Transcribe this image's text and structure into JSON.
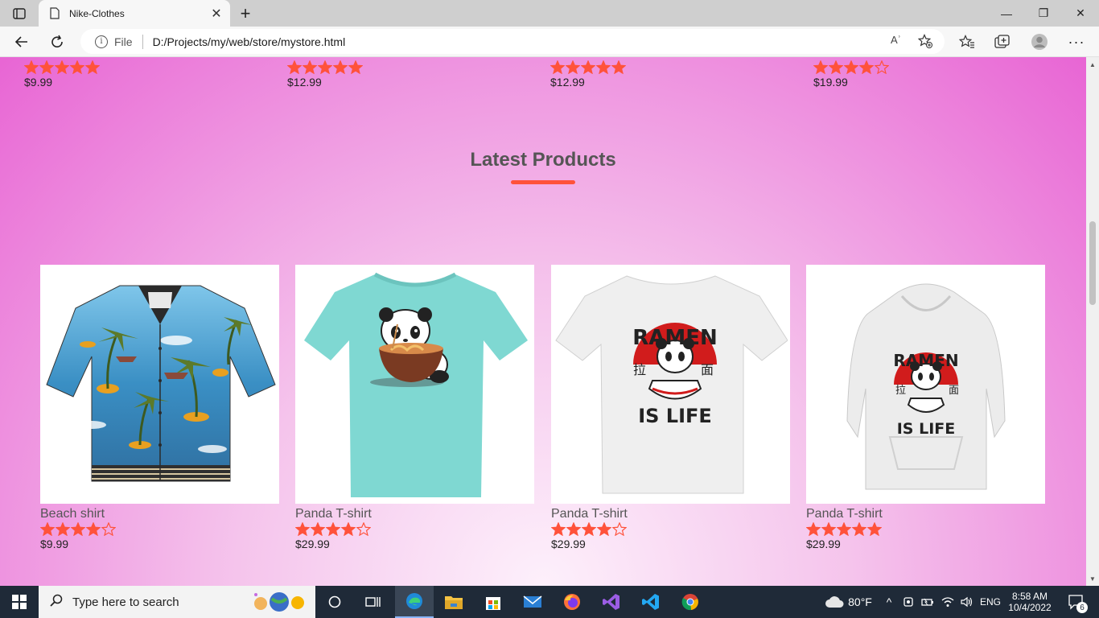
{
  "browser": {
    "tab_title": "Nike-Clothes",
    "address_prefix": "File",
    "url": "D:/Projects/my/web/store/mystore.html",
    "read_aloud": "Aʾ"
  },
  "top_row": [
    {
      "rating": 5,
      "price": "$9.99"
    },
    {
      "rating": 5,
      "price": "$12.99"
    },
    {
      "rating": 5,
      "price": "$12.99"
    },
    {
      "rating": 4,
      "price": "$19.99"
    }
  ],
  "section": {
    "title": "Latest Products",
    "underline_color": "#ff523b"
  },
  "products": [
    {
      "name": "Beach shirt",
      "rating": 4,
      "price": "$9.99",
      "image": "hawaiian-shirt"
    },
    {
      "name": "Panda T-shirt",
      "rating": 4,
      "price": "$29.99",
      "image": "panda-teal-tshirt"
    },
    {
      "name": "Panda T-shirt",
      "rating": 4,
      "price": "$29.99",
      "image": "ramen-white-tshirt"
    },
    {
      "name": "Panda T-shirt",
      "rating": 5,
      "price": "$29.99",
      "image": "ramen-hoodie"
    }
  ],
  "image_text": {
    "ramen_top": "RAMEN",
    "ramen_bottom": "IS LIFE",
    "kanji_left": "拉",
    "kanji_right": "面"
  },
  "taskbar": {
    "search_placeholder": "Type here to search",
    "weather": "80°F",
    "lang": "ENG",
    "time": "8:58 AM",
    "date": "10/4/2022",
    "notif_count": "6"
  },
  "colors": {
    "star": "#ff523b",
    "accent": "#ff523b"
  }
}
